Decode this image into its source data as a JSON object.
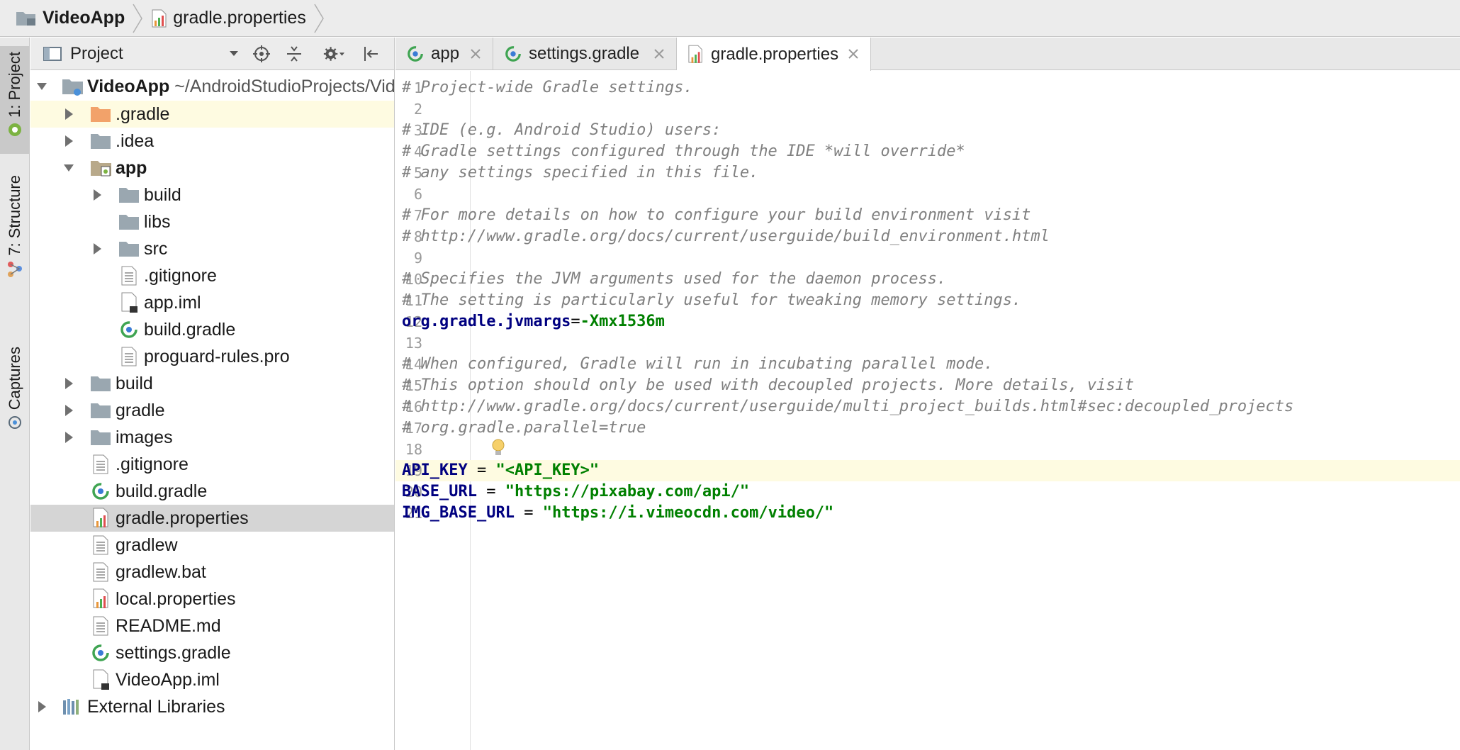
{
  "breadcrumb": {
    "project": "VideoApp",
    "file": "gradle.properties"
  },
  "toolstrip": {
    "project_tab": "1: Project",
    "structure_tab": "7: Structure",
    "captures_tab": "Captures"
  },
  "project_panel": {
    "title": "Project",
    "tree": [
      {
        "label": "VideoApp",
        "path": "~/AndroidStudioProjects/VideoApp",
        "icon": "module-folder-icon",
        "bold": true
      },
      {
        "label": ".gradle",
        "icon": "folder-orange-icon"
      },
      {
        "label": ".idea",
        "icon": "folder-icon"
      },
      {
        "label": "app",
        "icon": "module-folder-icon",
        "bold": true
      },
      {
        "label": "build",
        "icon": "folder-icon"
      },
      {
        "label": "libs",
        "icon": "folder-icon"
      },
      {
        "label": "src",
        "icon": "folder-icon"
      },
      {
        "label": ".gitignore",
        "icon": "text-file-icon"
      },
      {
        "label": "app.iml",
        "icon": "iml-file-icon"
      },
      {
        "label": "build.gradle",
        "icon": "gradle-file-icon"
      },
      {
        "label": "proguard-rules.pro",
        "icon": "text-file-icon"
      },
      {
        "label": "build",
        "icon": "folder-icon"
      },
      {
        "label": "gradle",
        "icon": "folder-icon"
      },
      {
        "label": "images",
        "icon": "folder-icon"
      },
      {
        "label": ".gitignore",
        "icon": "text-file-icon"
      },
      {
        "label": "build.gradle",
        "icon": "gradle-file-icon"
      },
      {
        "label": "gradle.properties",
        "icon": "properties-file-icon"
      },
      {
        "label": "gradlew",
        "icon": "text-file-icon"
      },
      {
        "label": "gradlew.bat",
        "icon": "text-file-icon"
      },
      {
        "label": "local.properties",
        "icon": "properties-file-icon"
      },
      {
        "label": "README.md",
        "icon": "text-file-icon"
      },
      {
        "label": "settings.gradle",
        "icon": "gradle-file-icon"
      },
      {
        "label": "VideoApp.iml",
        "icon": "iml-file-icon"
      },
      {
        "label": "External Libraries",
        "icon": "library-icon"
      }
    ]
  },
  "editor": {
    "tabs": [
      {
        "label": "app",
        "icon": "gradle-file-icon"
      },
      {
        "label": "settings.gradle",
        "icon": "gradle-file-icon"
      },
      {
        "label": "gradle.properties",
        "icon": "properties-file-icon"
      }
    ],
    "line_numbers": [
      "1",
      "2",
      "3",
      "4",
      "5",
      "6",
      "7",
      "8",
      "9",
      "10",
      "11",
      "12",
      "13",
      "14",
      "15",
      "16",
      "17",
      "18",
      "19",
      "20",
      "21"
    ],
    "lines": [
      {
        "comment": "# Project-wide Gradle settings."
      },
      {
        "comment": ""
      },
      {
        "comment": "# IDE (e.g. Android Studio) users:"
      },
      {
        "comment": "# Gradle settings configured through the IDE *will override*"
      },
      {
        "comment": "# any settings specified in this file."
      },
      {
        "comment": ""
      },
      {
        "comment": "# For more details on how to configure your build environment visit"
      },
      {
        "comment": "# http://www.gradle.org/docs/current/userguide/build_environment.html"
      },
      {
        "comment": ""
      },
      {
        "comment": "# Specifies the JVM arguments used for the daemon process."
      },
      {
        "comment": "# The setting is particularly useful for tweaking memory settings."
      },
      {
        "key": "org.gradle.jvmargs",
        "eq": "=",
        "value": "-Xmx1536m"
      },
      {
        "comment": ""
      },
      {
        "comment": "# When configured, Gradle will run in incubating parallel mode."
      },
      {
        "comment": "# This option should only be used with decoupled projects. More details, visit"
      },
      {
        "comment": "# http://www.gradle.org/docs/current/userguide/multi_project_builds.html#sec:decoupled_projects"
      },
      {
        "comment": "# org.gradle.parallel=true"
      },
      {
        "comment": ""
      },
      {
        "key": "API_KEY",
        "eq": " = ",
        "value": "\"<API_KEY>\""
      },
      {
        "key": "BASE_URL",
        "eq": " = ",
        "value": "\"https://pixabay.com/api/\""
      },
      {
        "key": "IMG_BASE_URL",
        "eq": " = ",
        "value": "\"https://i.vimeocdn.com/video/\""
      }
    ]
  },
  "colors": {
    "comment": "#808080",
    "key": "#000080",
    "value": "#008000",
    "current_line": "#fefbe1"
  }
}
